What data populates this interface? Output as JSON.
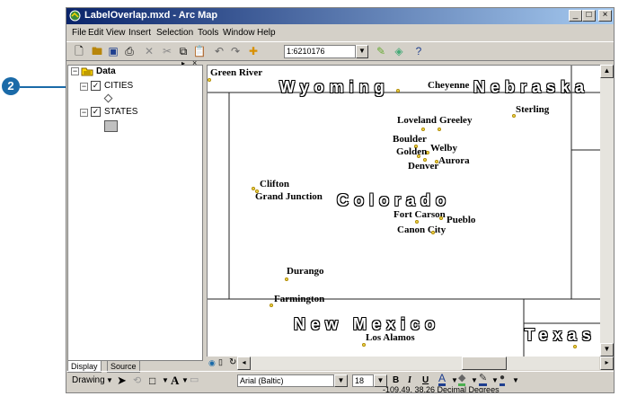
{
  "callout": {
    "number": "2"
  },
  "window": {
    "title": "LabelOverlap.mxd - Arc Map",
    "controls": [
      "_",
      "□",
      "×"
    ]
  },
  "menu": [
    "File",
    "Edit",
    "View",
    "Insert",
    "Selection",
    "Tools",
    "Window",
    "Help"
  ],
  "toolbar": {
    "scale": "1:6210176"
  },
  "toc": {
    "data_frame": "Data",
    "layers": [
      {
        "name": "CITIES",
        "checked": true,
        "symbol": "point"
      },
      {
        "name": "STATES",
        "checked": true,
        "symbol": "polygon"
      }
    ],
    "tabs": [
      "Display",
      "Source"
    ]
  },
  "map": {
    "states": [
      "Wyoming",
      "Nebraska",
      "Colorado",
      "New Mexico",
      "Texas"
    ],
    "cities": [
      "Green River",
      "Cheyenne",
      "Sterling",
      "Loveland",
      "Greeley",
      "Boulder",
      "Welby",
      "Golden",
      "Aurora",
      "Denver",
      "Clifton",
      "Grand Junction",
      "Fort Carson",
      "Pueblo",
      "Canon City",
      "Durango",
      "Farmington",
      "Los Alamos"
    ]
  },
  "drawing": {
    "label": "Drawing",
    "font": "Arial (Baltic)",
    "size": "18",
    "bold": "B",
    "italic": "I",
    "underline": "U"
  },
  "status": {
    "coords": "-109.49, 38.26 Decimal Degrees"
  },
  "colors": {
    "title_start": "#0a246a",
    "title_end": "#a6caf0",
    "callout": "#1a6aa8",
    "label_halo": "#000000"
  }
}
